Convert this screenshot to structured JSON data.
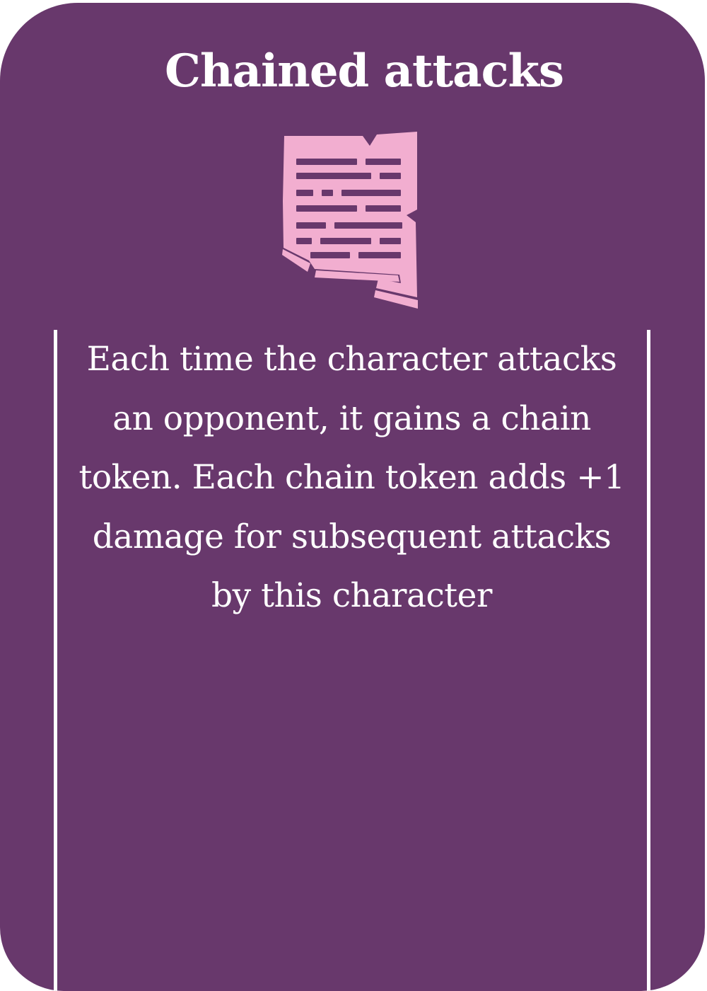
{
  "card": {
    "title": "Chained attacks",
    "description": "Each time the character attacks an opponent, it gains a chain token. Each chain token adds +1 damage for subsequent attacks by this character",
    "icon": "torn-scroll-icon"
  },
  "colors": {
    "background": "#68386c",
    "text": "#ffffff",
    "rule": "#ffffff",
    "icon": "#f2aed0"
  }
}
